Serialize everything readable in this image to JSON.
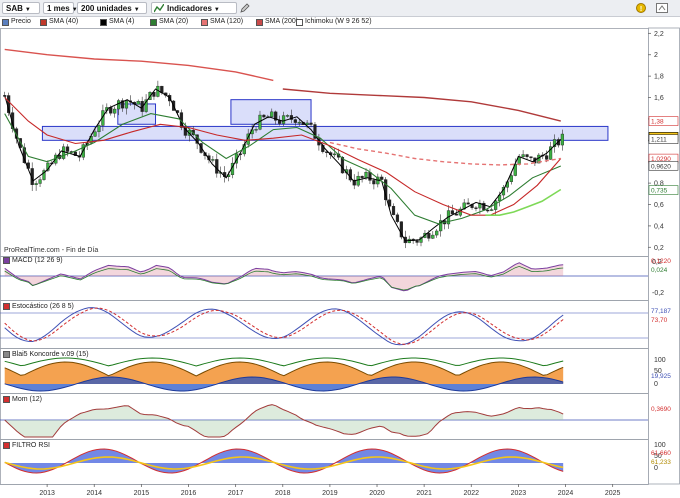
{
  "toolbar": {
    "symbol": "SAB",
    "period": "1 mes",
    "units": "200 unidades",
    "indicators": "Indicadores"
  },
  "price_legend": [
    {
      "label": "Precio",
      "color": "#5a7fbf"
    },
    {
      "label": "SMA (40)",
      "color": "#c0392b"
    },
    {
      "label": "SMA (4)",
      "color": "#000000"
    },
    {
      "label": "SMA (20)",
      "color": "#2e7d32"
    },
    {
      "label": "SMA (120)",
      "color": "#e57373"
    },
    {
      "label": "SMA (200)",
      "color": "#c94a4a"
    },
    {
      "label": "Ichimoku (W 9 26 52)",
      "color": "#ffffff"
    }
  ],
  "source": "ProRealTime.com - Fin de Día",
  "panels": {
    "macd": "MACD (12 26 9)",
    "stoch": "Estocástico (26 8 5)",
    "blai": "Blai5 Koncorde v.09 (15)",
    "mom": "Mom (12)",
    "rsi": "FILTRO RSI"
  },
  "price_axis": {
    "ticks": [
      "2,2",
      "2",
      "1,8",
      "1,6",
      "1,4",
      "1,2",
      "1",
      "0,8",
      "0,6",
      "0,4",
      "0,2"
    ],
    "badges": [
      {
        "text": "1,38",
        "color": "#d32f2f",
        "bg": "#fff"
      },
      {
        "text": "1,2325",
        "color": "#000",
        "bg": "#f5c518"
      },
      {
        "text": "1,211",
        "color": "#333",
        "bg": "#fff"
      },
      {
        "text": "1,0290",
        "color": "#d32f2f",
        "bg": "#fff"
      },
      {
        "text": "0,9620",
        "color": "#333",
        "bg": "#fff"
      },
      {
        "text": "0,735",
        "color": "#2e7d32",
        "bg": "#fff"
      }
    ]
  },
  "macd_axis": {
    "ticks": [
      "0,2",
      "-0,2"
    ],
    "badges": [
      {
        "text": "0,1220",
        "color": "#d32f2f"
      },
      {
        "text": "0,024",
        "color": "#2e7d32"
      }
    ]
  },
  "stoch_axis": {
    "badges": [
      {
        "text": "77,187",
        "color": "#3f51b5"
      },
      {
        "text": "73,70",
        "color": "#d32f2f"
      }
    ]
  },
  "blai_axis": {
    "ticks": [
      "100",
      "50",
      "0"
    ],
    "badges": [
      {
        "text": "19,925",
        "color": "#3f51b5"
      }
    ]
  },
  "mom_axis": {
    "badges": [
      {
        "text": "0,3690",
        "color": "#d32f2f"
      }
    ]
  },
  "rsi_axis": {
    "ticks": [
      "100",
      "50",
      "0"
    ],
    "badges": [
      {
        "text": "61,660",
        "color": "#d32f2f"
      },
      {
        "text": "61,233",
        "color": "#f5c518"
      }
    ]
  },
  "x_axis": [
    "2013",
    "2014",
    "2015",
    "2016",
    "2017",
    "2018",
    "2019",
    "2020",
    "2021",
    "2022",
    "2023",
    "2024",
    "2025"
  ],
  "chart_data": {
    "type": "line",
    "x_unit": "year",
    "y_unit": "EUR",
    "ylim": [
      0.1,
      2.25
    ],
    "series": [
      {
        "name": "SMA (4)",
        "points": [
          [
            2012.1,
            1.62
          ],
          [
            2012.4,
            1.15
          ],
          [
            2012.7,
            0.82
          ],
          [
            2013.0,
            0.92
          ],
          [
            2013.3,
            1.1
          ],
          [
            2013.7,
            1.05
          ],
          [
            2014.0,
            1.3
          ],
          [
            2014.3,
            1.5
          ],
          [
            2014.7,
            1.58
          ],
          [
            2015.0,
            1.5
          ],
          [
            2015.3,
            1.68
          ],
          [
            2015.6,
            1.6
          ],
          [
            2015.9,
            1.32
          ],
          [
            2016.2,
            1.18
          ],
          [
            2016.5,
            0.98
          ],
          [
            2016.8,
            0.85
          ],
          [
            2017.1,
            1.08
          ],
          [
            2017.4,
            1.35
          ],
          [
            2017.7,
            1.42
          ],
          [
            2018.0,
            1.38
          ],
          [
            2018.3,
            1.42
          ],
          [
            2018.6,
            1.3
          ],
          [
            2018.9,
            1.12
          ],
          [
            2019.2,
            0.98
          ],
          [
            2019.5,
            0.82
          ],
          [
            2019.8,
            0.85
          ],
          [
            2020.1,
            0.82
          ],
          [
            2020.3,
            0.5
          ],
          [
            2020.6,
            0.26
          ],
          [
            2020.9,
            0.27
          ],
          [
            2021.2,
            0.38
          ],
          [
            2021.5,
            0.48
          ],
          [
            2021.8,
            0.55
          ],
          [
            2022.1,
            0.62
          ],
          [
            2022.4,
            0.58
          ],
          [
            2022.7,
            0.75
          ],
          [
            2023.0,
            1.05
          ],
          [
            2023.3,
            1.0
          ],
          [
            2023.6,
            1.08
          ],
          [
            2023.9,
            1.21
          ]
        ]
      },
      {
        "name": "SMA (20)",
        "points": [
          [
            2012.1,
            1.45
          ],
          [
            2012.6,
            1.05
          ],
          [
            2013.0,
            1.0
          ],
          [
            2013.6,
            1.1
          ],
          [
            2014.0,
            1.18
          ],
          [
            2014.6,
            1.35
          ],
          [
            2015.2,
            1.45
          ],
          [
            2015.8,
            1.4
          ],
          [
            2016.3,
            1.18
          ],
          [
            2016.8,
            1.03
          ],
          [
            2017.3,
            1.15
          ],
          [
            2017.8,
            1.3
          ],
          [
            2018.3,
            1.32
          ],
          [
            2018.8,
            1.22
          ],
          [
            2019.3,
            1.02
          ],
          [
            2019.8,
            0.92
          ],
          [
            2020.3,
            0.75
          ],
          [
            2020.8,
            0.5
          ],
          [
            2021.3,
            0.42
          ],
          [
            2021.8,
            0.47
          ],
          [
            2022.3,
            0.55
          ],
          [
            2022.8,
            0.68
          ],
          [
            2023.3,
            0.85
          ],
          [
            2023.9,
            0.96
          ]
        ]
      },
      {
        "name": "SMA (40)",
        "points": [
          [
            2012.1,
            1.6
          ],
          [
            2012.6,
            1.38
          ],
          [
            2013.0,
            1.25
          ],
          [
            2013.6,
            1.17
          ],
          [
            2014.2,
            1.2
          ],
          [
            2014.8,
            1.28
          ],
          [
            2015.4,
            1.35
          ],
          [
            2016.0,
            1.32
          ],
          [
            2016.6,
            1.25
          ],
          [
            2017.2,
            1.2
          ],
          [
            2017.8,
            1.22
          ],
          [
            2018.4,
            1.25
          ],
          [
            2019.0,
            1.15
          ],
          [
            2019.6,
            1.02
          ],
          [
            2020.2,
            0.9
          ],
          [
            2020.8,
            0.72
          ],
          [
            2021.4,
            0.6
          ],
          [
            2022.0,
            0.5
          ],
          [
            2022.4,
            0.5
          ],
          [
            2022.9,
            0.6
          ],
          [
            2023.4,
            0.78
          ],
          [
            2023.9,
            1.03
          ]
        ]
      },
      {
        "name": "SMA (120)",
        "points": [
          [
            2019.0,
            1.18
          ],
          [
            2019.6,
            1.12
          ],
          [
            2020.2,
            1.08
          ],
          [
            2020.8,
            1.03
          ],
          [
            2021.4,
            1.0
          ],
          [
            2022.0,
            0.98
          ],
          [
            2022.6,
            0.97
          ],
          [
            2023.2,
            0.98
          ],
          [
            2023.9,
            1.03
          ]
        ]
      },
      {
        "name": "SMA (200)",
        "points": [
          [
            2012.1,
            2.05
          ],
          [
            2013.0,
            2.0
          ],
          [
            2014.0,
            1.96
          ],
          [
            2015.0,
            1.94
          ],
          [
            2016.0,
            1.9
          ],
          [
            2017.0,
            1.84
          ],
          [
            2017.8,
            1.76
          ],
          [
            2018.3,
            1.68
          ],
          [
            2019.0,
            1.68
          ],
          [
            2020.0,
            1.66
          ],
          [
            2021.0,
            1.62
          ],
          [
            2022.0,
            1.58
          ],
          [
            2023.0,
            1.52
          ],
          [
            2023.9,
            1.39
          ]
        ]
      },
      {
        "name": "SMA 200 (lower)",
        "points": [
          [
            2018.0,
            1.68
          ],
          [
            2019.0,
            1.64
          ],
          [
            2020.0,
            1.62
          ],
          [
            2021.0,
            1.6
          ],
          [
            2022.0,
            1.56
          ],
          [
            2023.0,
            1.48
          ],
          [
            2023.9,
            1.38
          ]
        ]
      },
      {
        "name": "Ichimoku",
        "points": [
          [
            2022.3,
            0.5
          ],
          [
            2022.6,
            0.5
          ],
          [
            2022.9,
            0.53
          ],
          [
            2023.2,
            0.58
          ],
          [
            2023.5,
            0.63
          ],
          [
            2023.9,
            0.74
          ]
        ]
      }
    ],
    "zones": [
      {
        "x1": 2012.9,
        "x2": 2024.9,
        "y1": 1.2,
        "y2": 1.33
      },
      {
        "x1": 2014.5,
        "x2": 2015.3,
        "y1": 1.35,
        "y2": 1.54
      },
      {
        "x1": 2016.9,
        "x2": 2018.6,
        "y1": 1.35,
        "y2": 1.58
      }
    ],
    "close": 1.2325
  }
}
